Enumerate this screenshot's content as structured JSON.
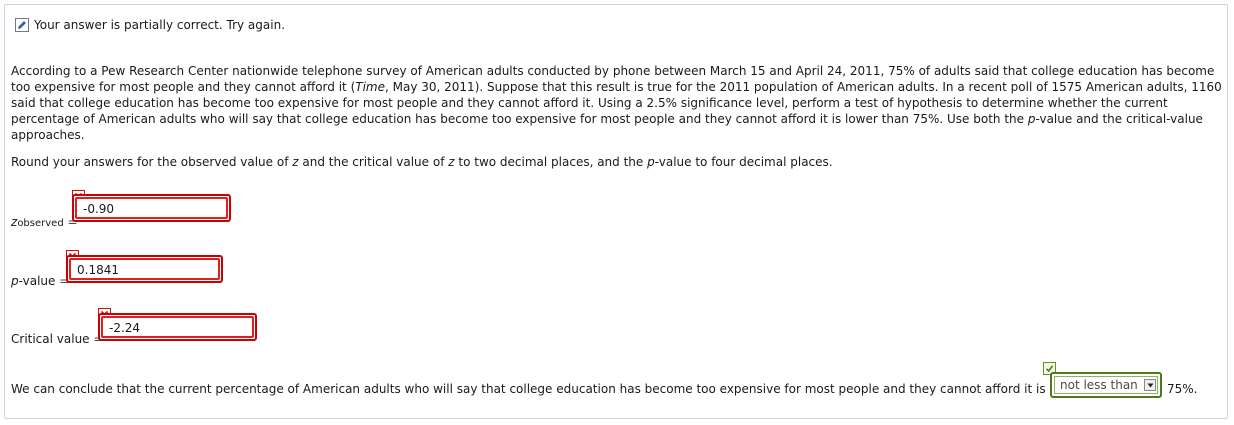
{
  "status": {
    "message": "Your answer is partially correct.  Try again.",
    "icon": "pencil-icon"
  },
  "question": {
    "p1": "According to a Pew Research Center nationwide telephone survey of American adults conducted by phone between March 15 and April 24, 2011, 75% of adults said that college education has become too expensive for most people and they cannot afford it (",
    "source_italic": "Time",
    "p2": ", May 30, 2011). Suppose that this result is true for the 2011 population of American adults. In a recent poll of 1575 American adults, 1160 said that college education has become too expensive for most people and they cannot afford it. Using a 2.5% significance level, perform a test of hypothesis to determine whether the current percentage of American adults who will say that college education has become too expensive for most people and they cannot afford it is lower than 75%. Use both the ",
    "pvalue_italic": "p",
    "p3": "-value and the critical-value approaches."
  },
  "instructions": {
    "t1": "Round your answers for the observed value of ",
    "z1": "z",
    "t2": " and the critical value of ",
    "z2": "z",
    "t3": " to two decimal places, and the ",
    "p": "p",
    "t4": "-value to four decimal places."
  },
  "answers": {
    "z_observed": {
      "label_main": "z",
      "label_sub": "observed",
      "eq": "=",
      "value": "-0.90",
      "status": "incorrect"
    },
    "p_value": {
      "label_italic": "p",
      "label_rest": "-value",
      "eq": "=",
      "value": "0.1841",
      "status": "incorrect"
    },
    "critical": {
      "label": "Critical value",
      "eq": "=",
      "value": "-2.24",
      "status": "incorrect"
    }
  },
  "conclusion": {
    "text": "We can conclude that the current percentage of American adults who will say that college education has become too expensive for most people and they cannot afford it is",
    "select_value": "not less than",
    "tail": "75%.",
    "status": "correct"
  },
  "colors": {
    "error_red": "#cc0000",
    "correct_green": "#4e7a1c",
    "frame_border": "#c9d3df"
  }
}
